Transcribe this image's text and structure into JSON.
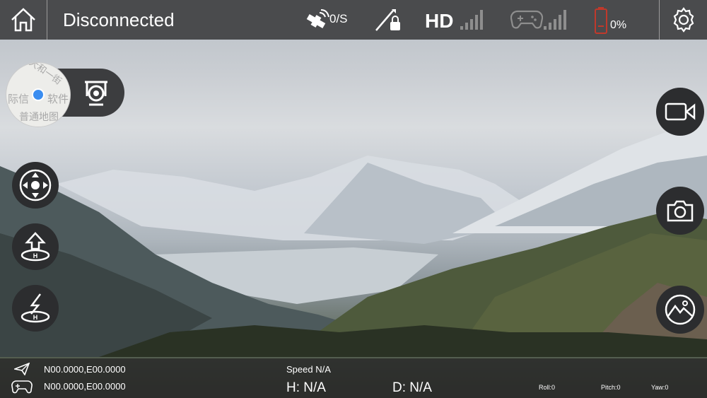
{
  "topbar": {
    "connection_status": "Disconnected",
    "gps_rate": "0/S",
    "video_quality_label": "HD",
    "battery_percent": "0%"
  },
  "bottombar": {
    "aircraft_coords": "N00.0000,E00.0000",
    "controller_coords": "N00.0000,E00.0000",
    "speed": "Speed N/A",
    "height": "H: N/A",
    "distance": "D: N/A",
    "roll": "Roll:0",
    "pitch": "Pitch:0",
    "yaw": "Yaw:0"
  },
  "map_preview": {
    "labels": [
      "大和一街",
      "际信",
      "软件",
      "普通地图"
    ]
  },
  "icons": [
    "home-icon",
    "satellite-icon",
    "lock-icon",
    "signal-bars-icon",
    "gamepad-icon",
    "battery-icon",
    "settings-icon",
    "location-dot-icon",
    "gimbal-camera-icon",
    "dpad-icon",
    "takeoff-icon",
    "landing-icon",
    "video-camera-icon",
    "camera-icon",
    "gallery-icon",
    "paper-plane-icon",
    "controller-icon"
  ],
  "colors": {
    "topbar": "#4a4b4d",
    "button": "#2c2d2f",
    "location_dot": "#3a8df0",
    "battery_red": "#c0392b"
  }
}
